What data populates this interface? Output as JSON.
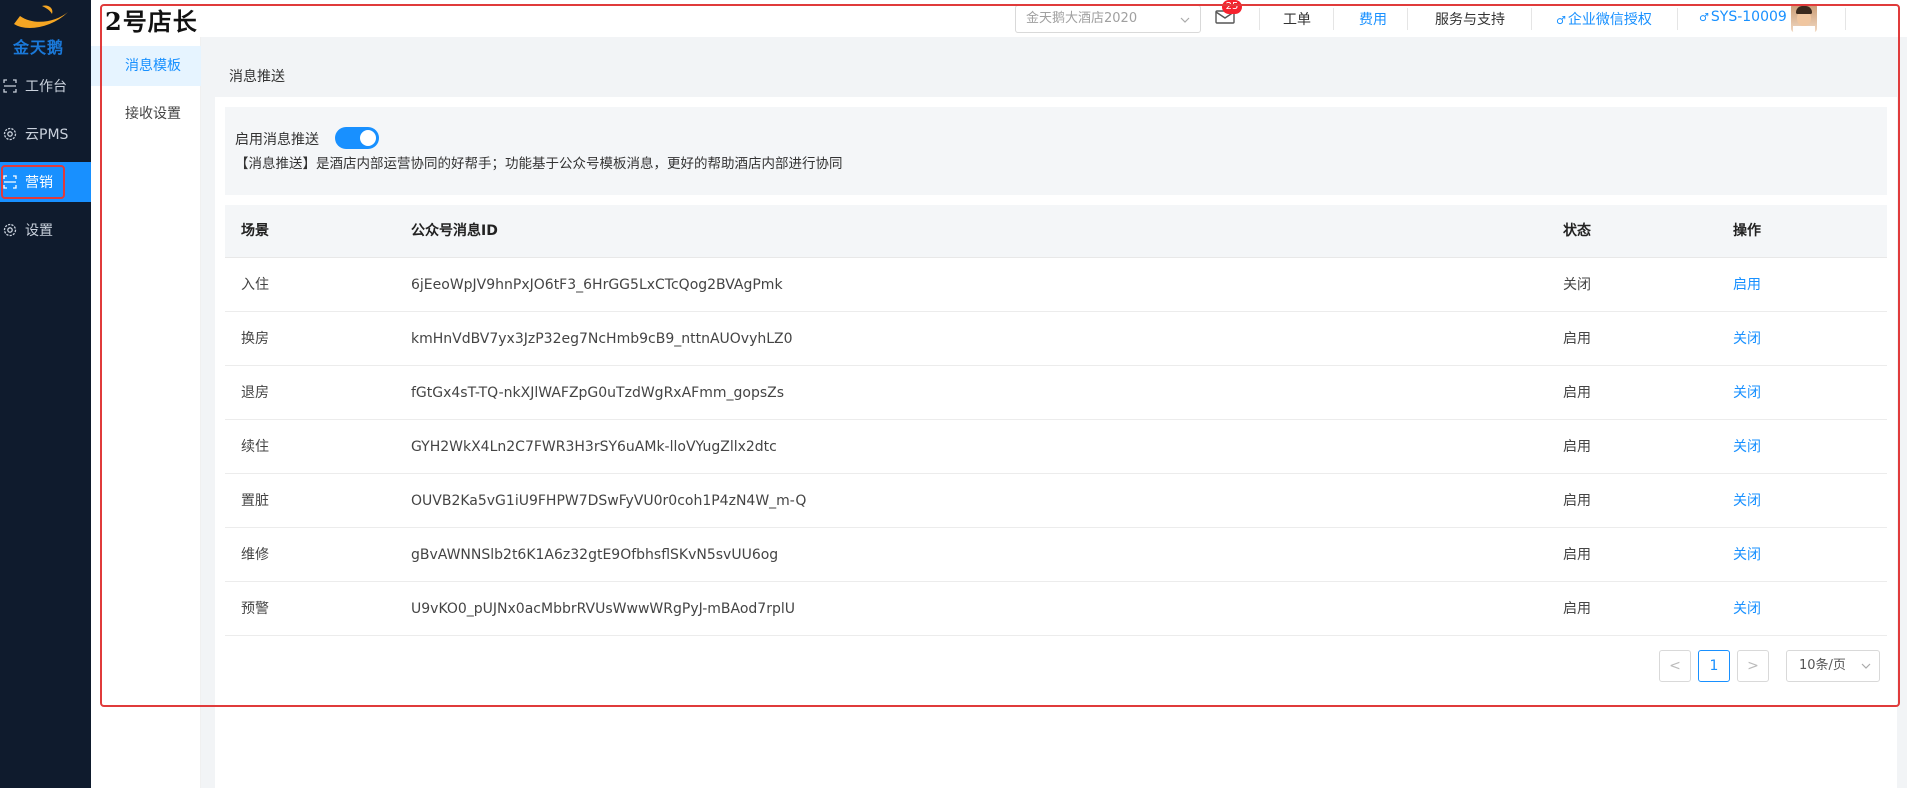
{
  "brand": {
    "name": "金天鹅",
    "accent": "#1890ff",
    "sidebar_bg": "#0f1b2d",
    "highlight": "#e03b3b"
  },
  "sidebar": {
    "items": [
      {
        "label": "工作台",
        "icon": "scan-icon"
      },
      {
        "label": "云PMS",
        "icon": "gear-icon"
      },
      {
        "label": "营销",
        "icon": "scan-icon",
        "active": true
      },
      {
        "label": "设置",
        "icon": "gear-icon"
      }
    ]
  },
  "header": {
    "store_title": "2号店长",
    "hotel_select": {
      "value": "金天鹅大酒店2020"
    },
    "mail_badge": "25",
    "links": {
      "work_order": "工单",
      "fees": "费用",
      "support": "服务与支持",
      "wechat_auth": "企业微信授权",
      "user": "SYS-10009"
    }
  },
  "submenu": {
    "items": [
      {
        "label": "消息模板",
        "active": true
      },
      {
        "label": "接收设置"
      }
    ]
  },
  "main": {
    "section_title": "消息推送",
    "notice": {
      "toggle_label": "启用消息推送",
      "toggle_on": true,
      "description": "【消息推送】是酒店内部运营协同的好帮手；功能基于公众号模板消息，更好的帮助酒店内部进行协同"
    },
    "table": {
      "headers": [
        "场景",
        "公众号消息ID",
        "状态",
        "操作"
      ],
      "rows": [
        {
          "scene": "入住",
          "msg_id": "6jEeoWpJV9hnPxJO6tF3_6HrGG5LxCTcQog2BVAgPmk",
          "status": "关闭",
          "action": "启用"
        },
        {
          "scene": "换房",
          "msg_id": "kmHnVdBV7yx3JzP32eg7NcHmb9cB9_nttnAUOvyhLZ0",
          "status": "启用",
          "action": "关闭"
        },
        {
          "scene": "退房",
          "msg_id": "fGtGx4sT-TQ-nkXJlWAFZpG0uTzdWgRxAFmm_gopsZs",
          "status": "启用",
          "action": "关闭"
        },
        {
          "scene": "续住",
          "msg_id": "GYH2WkX4Ln2C7FWR3H3rSY6uAMk-lloVYugZllx2dtc",
          "status": "启用",
          "action": "关闭"
        },
        {
          "scene": "置脏",
          "msg_id": "OUVB2Ka5vG1iU9FHPW7DSwFyVU0r0coh1P4zN4W_m-Q",
          "status": "启用",
          "action": "关闭"
        },
        {
          "scene": "维修",
          "msg_id": "gBvAWNNSlb2t6K1A6z32gtE9OfbhsflSKvN5svUU6og",
          "status": "启用",
          "action": "关闭"
        },
        {
          "scene": "预警",
          "msg_id": "U9vKO0_pUJNx0acMbbrRVUsWwwWRgPyJ-mBAod7rplU",
          "status": "启用",
          "action": "关闭"
        }
      ]
    },
    "pagination": {
      "prev": "<",
      "current": "1",
      "next": ">",
      "page_size": "10条/页"
    }
  }
}
